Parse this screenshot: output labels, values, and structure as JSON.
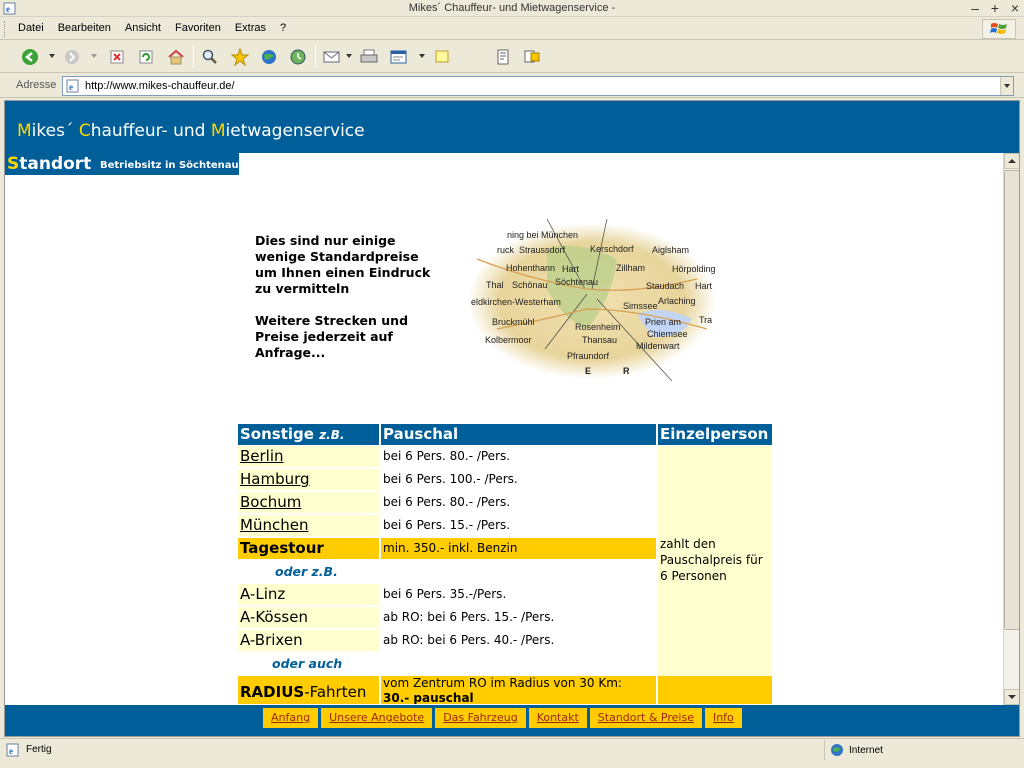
{
  "window": {
    "title": "Mikes´ Chauffeur- und Mietwagenservice -",
    "min_glyph": "–",
    "max_glyph": "+",
    "close_glyph": "×"
  },
  "menu": [
    "Datei",
    "Bearbeiten",
    "Ansicht",
    "Favoriten",
    "Extras",
    "?"
  ],
  "toolbar": {
    "icons": [
      "back-icon",
      "forward-icon",
      "stop-icon",
      "refresh-icon",
      "home-icon",
      "search-icon",
      "favorites-icon",
      "media-icon",
      "history-icon",
      "mail-icon",
      "print-icon",
      "edit-icon",
      "discuss-icon",
      "research-icon",
      "messenger-icon"
    ]
  },
  "address": {
    "label": "Adresse",
    "url": "http://www.mikes-chauffeur.de/"
  },
  "site": {
    "title_parts": [
      {
        "cap": "M",
        "rest": "ikes´ "
      },
      {
        "cap": "C",
        "rest": "hauffeur- und "
      },
      {
        "cap": "M",
        "rest": "ietwagenservice"
      }
    ],
    "section_cap": "S",
    "section_rest": "tandort",
    "section_sub": "Betriebsitz in Söchtenau",
    "intro_p1": "Dies sind nur einige wenige Standardpreise um Ihnen einen Eindruck zu vermitteln",
    "intro_p2": "Weitere Strecken und Preise jederzeit auf Anfrage...",
    "map_labels": [
      "ning bei München",
      "Straussdorf",
      "Kerschdorf",
      "Aiglsham",
      "ruck",
      "Hohenthann",
      "Hart",
      "Zillham",
      "Hörpolding",
      "Thal",
      "Schönau",
      "Söchtenau",
      "Staudach",
      "Hart",
      "eldkirchen-Westerham",
      "Simssee",
      "Arlaching",
      "Bruckmühl",
      "Rosenheim",
      "Prien am",
      "Chiemsee",
      "Tra",
      "Kolbermoor",
      "Thansau",
      "Mildenwart",
      "Pfraundorf",
      "E",
      "R"
    ]
  },
  "table": {
    "head": {
      "col1": "Sonstige",
      "col1_em": "z.B.",
      "col2": "Pauschal",
      "col3": "Einzelperson"
    },
    "cities": [
      {
        "name": "Berlin",
        "price": "bei 6 Pers. 80.- /Pers."
      },
      {
        "name": "Hamburg",
        "price": "bei 6 Pers. 100.- /Pers."
      },
      {
        "name": "Bochum",
        "price": "bei 6 Pers. 80.- /Pers."
      },
      {
        "name": "München",
        "price": "bei 6 Pers. 15.- /Pers."
      }
    ],
    "tagestour": {
      "name": "Tagestour",
      "price": "min. 350.- inkl. Benzin"
    },
    "oder_zb": "oder z.B.",
    "austria": [
      {
        "name": "A-Linz",
        "price": "bei 6 Pers. 35.-/Pers."
      },
      {
        "name": "A-Kössen",
        "price": "ab RO: bei 6 Pers. 15.- /Pers."
      },
      {
        "name": "A-Brixen",
        "price": "ab RO: bei 6 Pers. 40.- /Pers."
      }
    ],
    "oder_auch": "oder auch",
    "radius": {
      "bold": "RADIUS",
      "rest": "-Fahrten",
      "price": "vom Zentrum RO im Radius von 30 Km:",
      "price_bold": "30.- pauschal"
    },
    "einzel_text": "zahlt den Pauschalpreis für 6 Personen"
  },
  "footer_nav": [
    "Anfang",
    "Unsere Angebote",
    "Das Fahrzeug",
    "Kontakt",
    "Standort & Preise",
    "Info"
  ],
  "status": {
    "text": "Fertig",
    "zone": "Internet"
  }
}
